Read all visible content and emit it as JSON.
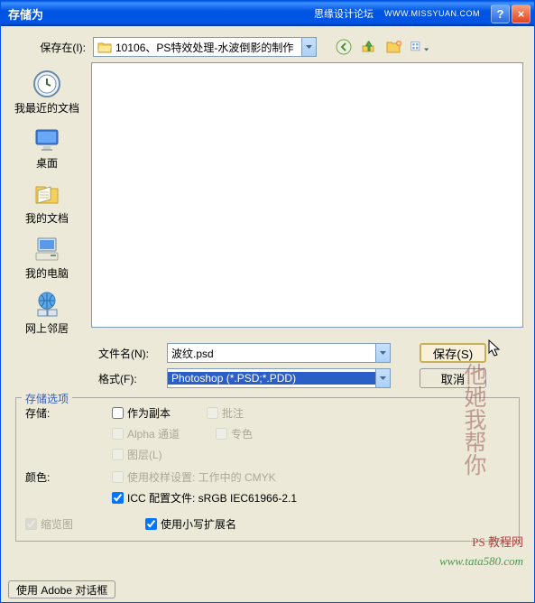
{
  "titlebar": {
    "title": "存储为",
    "brand": "思缘设计论坛",
    "brand_url": "WWW.MISSYUAN.COM"
  },
  "topbar": {
    "label": "保存在(I):",
    "path": "10106、PS特效处理-水波倒影的制作"
  },
  "sidebar": {
    "items": [
      {
        "label": "我最近的文档"
      },
      {
        "label": "桌面"
      },
      {
        "label": "我的文档"
      },
      {
        "label": "我的电脑"
      },
      {
        "label": "网上邻居"
      }
    ]
  },
  "filename": {
    "label": "文件名(N):",
    "value": "波纹.psd"
  },
  "format": {
    "label": "格式(F):",
    "value": "Photoshop (*.PSD;*.PDD)"
  },
  "actions": {
    "save": "保存(S)",
    "cancel": "取消"
  },
  "options": {
    "legend": "存储选项",
    "storage_label": "存储:",
    "as_copy": "作为副本",
    "annotations": "批注",
    "alpha": "Alpha 通道",
    "spot": "专色",
    "layers": "图层(L)",
    "color_label": "颜色:",
    "proof": "使用校样设置: 工作中的 CMYK",
    "icc": "ICC 配置文件: sRGB IEC61966-2.1",
    "thumbnail": "缩览图",
    "lowercase": "使用小写扩展名"
  },
  "footer": {
    "adobe_dialog": "使用 Adobe 对话框"
  },
  "watermark": {
    "line1": "PS 教程网",
    "line2": "www.tata580.com",
    "cn": "他她我帮你"
  }
}
